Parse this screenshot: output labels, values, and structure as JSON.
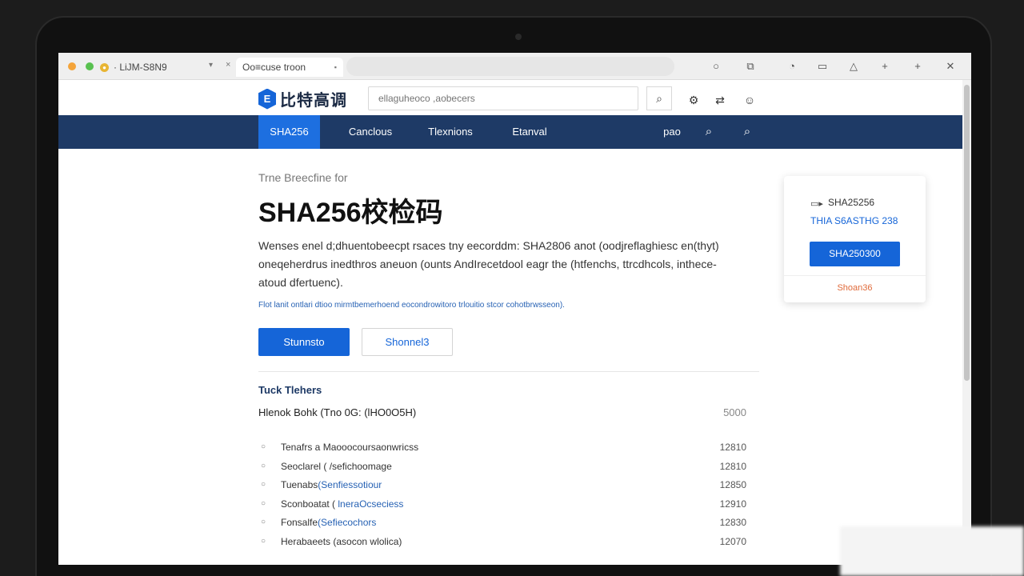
{
  "browser": {
    "tabs": [
      {
        "label": "· LiJM-S8N9"
      },
      {
        "label": "Oo≡cuse troon"
      }
    ]
  },
  "site": {
    "logo_text": "比特高调",
    "logo_mark": "E",
    "search_placeholder": "ellaguheoco ,aobecers"
  },
  "nav": {
    "items": [
      {
        "label": "SHA256",
        "active": true
      },
      {
        "label": "Canclous"
      },
      {
        "label": "Tlexnions"
      },
      {
        "label": "Etanval"
      }
    ],
    "right_label": "pao"
  },
  "main": {
    "breadcrumb": "Trne Breecfine for",
    "title": "SHA256校检码",
    "description": "Wenses enel d;dhuentobeecpt rsaces tny eecorddm: SHA2806 anot (oodjreflaghiesc en(thyt) oneqeherdrus inedthros aneuon (ounts AndIrecetdool eagr the (htfenchs, ttrcdhcols, inthece-atoud dfertuenc).",
    "small_link": "Flot lanit ontlari dtioo mirmtbemerhoend eocondrowitoro trlouitio stcor cohotbrwsseon).",
    "primary_button": "Stunnsto",
    "secondary_button": "Shonnel3",
    "section_title": "Tuck Tlehers",
    "list_header": {
      "label": "Hlenok Bohk  (Tno 0G:  (lHO0O5H)",
      "value": "5000"
    },
    "list": [
      {
        "label": "Tenafrs a Maooocoursaonwricss",
        "highlight": "",
        "value": "12810"
      },
      {
        "label": "Seoclarel ( /sefichoomage",
        "highlight": "",
        "value": "12810"
      },
      {
        "label": "Tuenabs",
        "highlight": "(Senfiessotiour",
        "value": "12850"
      },
      {
        "label": "Sconboatat  ( ",
        "highlight": "lneraOcseciess",
        "value": "12910"
      },
      {
        "label": "Fonsalfe",
        "highlight": "(Sefiecochors",
        "value": "12830"
      },
      {
        "label": "Herabaeets (asocon wlolica)",
        "highlight": "",
        "value": "12070"
      }
    ]
  },
  "side_card": {
    "title": "SHA25256",
    "subtitle": "THIA S6ASTHG 238",
    "button": "SHA250300",
    "link": "Shoan36"
  }
}
